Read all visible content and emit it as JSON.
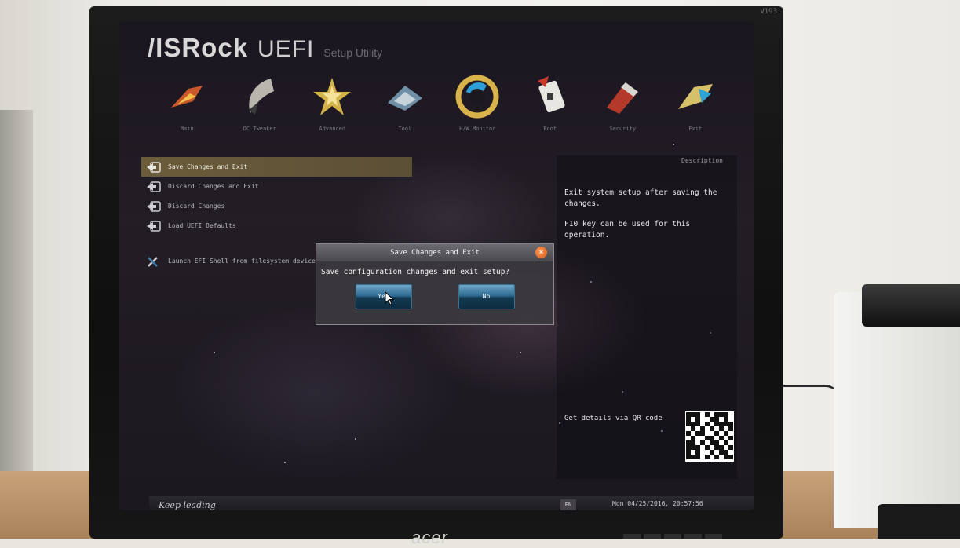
{
  "brand": {
    "logo": "/ISRock",
    "product": "UEFI",
    "subtitle": "Setup Utility"
  },
  "nav": [
    {
      "label": "Main",
      "icon": "main-icon"
    },
    {
      "label": "OC Tweaker",
      "icon": "oc-tweaker-icon"
    },
    {
      "label": "Advanced",
      "icon": "advanced-icon"
    },
    {
      "label": "Tool",
      "icon": "tool-icon"
    },
    {
      "label": "H/W Monitor",
      "icon": "hw-monitor-icon"
    },
    {
      "label": "Boot",
      "icon": "boot-icon"
    },
    {
      "label": "Security",
      "icon": "security-icon"
    },
    {
      "label": "Exit",
      "icon": "exit-icon"
    }
  ],
  "menu": {
    "items": [
      {
        "label": "Save Changes and Exit",
        "selected": true
      },
      {
        "label": "Discard Changes and Exit"
      },
      {
        "label": "Discard Changes"
      },
      {
        "label": "Load UEFI Defaults"
      },
      {
        "label": "Launch EFI Shell from filesystem device"
      }
    ]
  },
  "description": {
    "title": "Description",
    "line1": "Exit system setup after saving the changes.",
    "line2": "F10 key can be used for this operation.",
    "qr_label": "Get details via QR code"
  },
  "dialog": {
    "title": "Save Changes and Exit",
    "message": "Save configuration changes and exit setup?",
    "yes": "Yes",
    "no": "No"
  },
  "footer": {
    "slogan": "Keep leading",
    "language": "EN",
    "datetime": "Mon 04/25/2016, 20:57:56"
  },
  "monitor": {
    "brand": "acer",
    "model_label": "V193"
  },
  "colors": {
    "selection": "#6b5c3a",
    "button": "#2f6c93",
    "close": "#d2571b"
  }
}
